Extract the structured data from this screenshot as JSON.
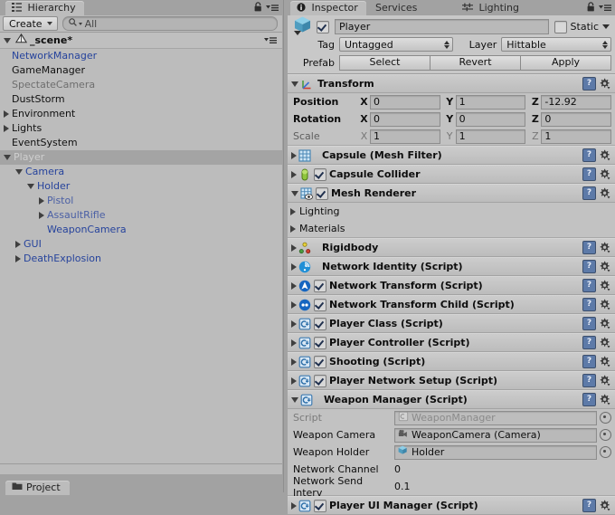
{
  "hierarchy": {
    "tab_label": "Hierarchy",
    "create_button": "Create",
    "search_placeholder": "All",
    "scene_name": "_scene*",
    "items": [
      {
        "label": "NetworkManager",
        "depth": 1,
        "arrow": "none",
        "color": "blue",
        "selected": false
      },
      {
        "label": "GameManager",
        "depth": 1,
        "arrow": "none",
        "color": "dark",
        "selected": false
      },
      {
        "label": "SpectateCamera",
        "depth": 1,
        "arrow": "none",
        "color": "gray",
        "selected": false
      },
      {
        "label": "DustStorm",
        "depth": 1,
        "arrow": "none",
        "color": "dark",
        "selected": false
      },
      {
        "label": "Environment",
        "depth": 1,
        "arrow": "closed",
        "color": "dark",
        "selected": false
      },
      {
        "label": "Lights",
        "depth": 1,
        "arrow": "closed",
        "color": "dark",
        "selected": false
      },
      {
        "label": "EventSystem",
        "depth": 1,
        "arrow": "none",
        "color": "dark",
        "selected": false
      },
      {
        "label": "Player",
        "depth": 1,
        "arrow": "open",
        "color": "selgray",
        "selected": true
      },
      {
        "label": "Camera",
        "depth": 2,
        "arrow": "open",
        "color": "blue",
        "selected": false
      },
      {
        "label": "Holder",
        "depth": 3,
        "arrow": "open",
        "color": "blue",
        "selected": false
      },
      {
        "label": "Pistol",
        "depth": 4,
        "arrow": "closed",
        "color": "lblue",
        "selected": false
      },
      {
        "label": "AssaultRifle",
        "depth": 4,
        "arrow": "closed",
        "color": "lblue",
        "selected": false
      },
      {
        "label": "WeaponCamera",
        "depth": 4,
        "arrow": "none",
        "color": "blue",
        "selected": false
      },
      {
        "label": "GUI",
        "depth": 2,
        "arrow": "closed",
        "color": "blue",
        "selected": false
      },
      {
        "label": "DeathExplosion",
        "depth": 2,
        "arrow": "closed",
        "color": "blue",
        "selected": false
      }
    ],
    "bottom_tab": "Project"
  },
  "inspector": {
    "tabs": [
      {
        "label": "Inspector",
        "icon": "info-icon",
        "active": true
      },
      {
        "label": "Services",
        "icon": "none",
        "active": false
      },
      {
        "label": "Lighting",
        "icon": "lighting-icon",
        "active": false
      }
    ],
    "object": {
      "enabled": true,
      "name": "Player",
      "static_label": "Static",
      "static_checked": false,
      "tag_label": "Tag",
      "tag_value": "Untagged",
      "layer_label": "Layer",
      "layer_value": "Hittable",
      "prefab_label": "Prefab",
      "prefab_buttons": [
        "Select",
        "Revert",
        "Apply"
      ]
    },
    "transform": {
      "title": "Transform",
      "rows": [
        {
          "label": "Position",
          "dim": false,
          "x": "0",
          "y": "1",
          "z": "-12.92"
        },
        {
          "label": "Rotation",
          "dim": false,
          "x": "0",
          "y": "0",
          "z": "0"
        },
        {
          "label": "Scale",
          "dim": true,
          "x": "1",
          "y": "1",
          "z": "1"
        }
      ],
      "axes": [
        "X",
        "Y",
        "Z"
      ]
    },
    "components": [
      {
        "title": "Capsule (Mesh Filter)",
        "icon": "mesh-filter-icon",
        "expanded": false,
        "has_toggle": false
      },
      {
        "title": "Capsule Collider",
        "icon": "capsule-collider-icon",
        "expanded": false,
        "has_toggle": true,
        "enabled": true
      },
      {
        "title": "Mesh Renderer",
        "icon": "mesh-renderer-icon",
        "expanded": true,
        "has_toggle": true,
        "enabled": true,
        "subfoldouts": [
          "Lighting",
          "Materials"
        ]
      },
      {
        "title": "Rigidbody",
        "icon": "rigidbody-icon",
        "expanded": false,
        "has_toggle": false
      },
      {
        "title": "Network Identity (Script)",
        "icon": "network-identity-icon",
        "expanded": false,
        "has_toggle": false
      },
      {
        "title": "Network Transform (Script)",
        "icon": "network-transform-icon",
        "expanded": false,
        "has_toggle": true,
        "enabled": true
      },
      {
        "title": "Network Transform Child (Script)",
        "icon": "network-transform-child-icon",
        "expanded": false,
        "has_toggle": true,
        "enabled": true
      },
      {
        "title": "Player Class (Script)",
        "icon": "csharp-script-icon",
        "expanded": false,
        "has_toggle": true,
        "enabled": true
      },
      {
        "title": "Player Controller (Script)",
        "icon": "csharp-script-icon",
        "expanded": false,
        "has_toggle": true,
        "enabled": true
      },
      {
        "title": "Shooting (Script)",
        "icon": "csharp-script-icon",
        "expanded": false,
        "has_toggle": true,
        "enabled": true
      },
      {
        "title": "Player Network Setup (Script)",
        "icon": "csharp-script-icon",
        "expanded": false,
        "has_toggle": true,
        "enabled": true
      }
    ],
    "weapon_manager": {
      "title": "Weapon Manager (Script)",
      "icon": "csharp-script-icon",
      "expanded": true,
      "enabled": true,
      "fields": [
        {
          "label": "Script",
          "type": "object",
          "value": "WeaponManager",
          "icon": "csharp-asset-icon",
          "dim": true
        },
        {
          "label": "Weapon Camera",
          "type": "object",
          "value": "WeaponCamera (Camera)",
          "icon": "camera-icon",
          "dim": false
        },
        {
          "label": "Weapon Holder",
          "type": "object",
          "value": "Holder",
          "icon": "gameobject-icon",
          "dim": false
        },
        {
          "label": "Network Channel",
          "type": "text",
          "value": "0"
        },
        {
          "label": "Network Send Interv",
          "type": "text",
          "value": "0.1"
        }
      ]
    },
    "last_component": {
      "title": "Player UI Manager (Script)",
      "icon": "csharp-script-icon",
      "expanded": false,
      "has_toggle": true,
      "enabled": true
    },
    "help_icon": "?",
    "gear_icon": "gear-icon"
  },
  "colors": {
    "panel_bg": "#c2c2c2",
    "hierarchy_bg": "#bcbcbc",
    "chrome_bg": "#a2a2a2",
    "selection": "#a4a4a4",
    "link_blue": "#26439c",
    "field_bg": "#b9b9b9"
  }
}
